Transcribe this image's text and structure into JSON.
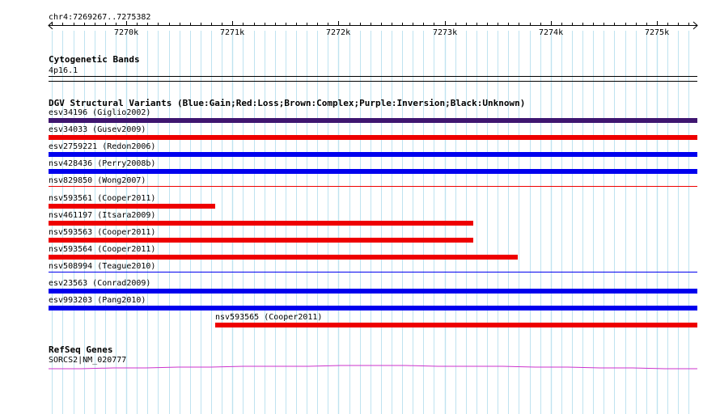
{
  "locus": "chr4:7269267..7275382",
  "ruler": {
    "start": 7269267,
    "end": 7275382,
    "ticks": [
      {
        "pos": 7270000,
        "label": "7270k"
      },
      {
        "pos": 7271000,
        "label": "7271k"
      },
      {
        "pos": 7272000,
        "label": "7272k"
      },
      {
        "pos": 7273000,
        "label": "7273k"
      },
      {
        "pos": 7274000,
        "label": "7274k"
      },
      {
        "pos": 7275000,
        "label": "7275k"
      }
    ]
  },
  "cytoband": {
    "title": "Cytogenetic Bands",
    "band": "4p16.1"
  },
  "dgv": {
    "title": "DGV Structural Variants (Blue:Gain;Red:Loss;Brown:Complex;Purple:Inversion;Black:Unknown)",
    "colors": {
      "gain": "#0000ee",
      "loss": "#ee0000",
      "inversion": "#3f1670",
      "unknown": "#000000"
    },
    "variants": [
      {
        "label": "esv34196 (Giglio2002)",
        "type": "inversion",
        "start": 7269267,
        "end": 7275382,
        "thin": false
      },
      {
        "label": "esv34033 (Gusev2009)",
        "type": "loss",
        "start": 7269267,
        "end": 7275382,
        "thin": false
      },
      {
        "label": "esv2759221 (Redon2006)",
        "type": "gain",
        "start": 7269267,
        "end": 7275382,
        "thin": false
      },
      {
        "label": "nsv428436 (Perry2008b)",
        "type": "gain",
        "start": 7269267,
        "end": 7275382,
        "thin": false
      },
      {
        "label": "nsv829850 (Wong2007)",
        "type": "loss",
        "start": 7269267,
        "end": 7275382,
        "thin": true
      },
      {
        "label": "nsv593561 (Cooper2011)",
        "type": "loss",
        "start": 7269267,
        "end": 7270840,
        "thin": false
      },
      {
        "label": "nsv461197 (Itsara2009)",
        "type": "loss",
        "start": 7269267,
        "end": 7273270,
        "thin": false
      },
      {
        "label": "nsv593563 (Cooper2011)",
        "type": "loss",
        "start": 7269267,
        "end": 7273270,
        "thin": false
      },
      {
        "label": "nsv593564 (Cooper2011)",
        "type": "loss",
        "start": 7269267,
        "end": 7273690,
        "thin": false
      },
      {
        "label": "nsv508994 (Teague2010)",
        "type": "gain",
        "start": 7269267,
        "end": 7275382,
        "thin": true
      },
      {
        "label": "esv23563 (Conrad2009)",
        "type": "gain",
        "start": 7269267,
        "end": 7275382,
        "thin": false
      },
      {
        "label": "esv993203 (Pang2010)",
        "type": "gain",
        "start": 7269267,
        "end": 7275382,
        "thin": false
      },
      {
        "label": "nsv593565 (Cooper2011)",
        "type": "loss",
        "start": 7270840,
        "end": 7275382,
        "thin": false
      }
    ]
  },
  "refseq": {
    "title": "RefSeq Genes",
    "gene_label": "SORCS2|NM_020777",
    "color": "#cc33cc"
  },
  "grid_color": "#bfe3f0"
}
